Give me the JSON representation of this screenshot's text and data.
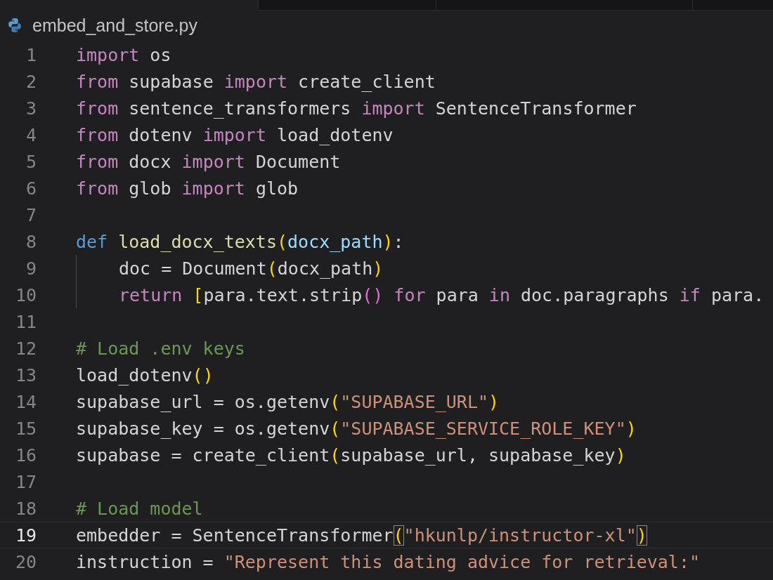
{
  "tab": {
    "title": "embed_and_store.py"
  },
  "lines": [
    {
      "number": "1",
      "current": false,
      "indent": false,
      "tokens": [
        {
          "kind": "keyword",
          "text": "import"
        },
        {
          "kind": "plain",
          "text": " os"
        }
      ]
    },
    {
      "number": "2",
      "current": false,
      "indent": false,
      "tokens": [
        {
          "kind": "keyword",
          "text": "from"
        },
        {
          "kind": "plain",
          "text": " supabase "
        },
        {
          "kind": "keyword",
          "text": "import"
        },
        {
          "kind": "plain",
          "text": " create_client"
        }
      ]
    },
    {
      "number": "3",
      "current": false,
      "indent": false,
      "tokens": [
        {
          "kind": "keyword",
          "text": "from"
        },
        {
          "kind": "plain",
          "text": " sentence_transformers "
        },
        {
          "kind": "keyword",
          "text": "import"
        },
        {
          "kind": "plain",
          "text": " SentenceTransformer"
        }
      ]
    },
    {
      "number": "4",
      "current": false,
      "indent": false,
      "tokens": [
        {
          "kind": "keyword",
          "text": "from"
        },
        {
          "kind": "plain",
          "text": " dotenv "
        },
        {
          "kind": "keyword",
          "text": "import"
        },
        {
          "kind": "plain",
          "text": " load_dotenv"
        }
      ]
    },
    {
      "number": "5",
      "current": false,
      "indent": false,
      "tokens": [
        {
          "kind": "keyword",
          "text": "from"
        },
        {
          "kind": "plain",
          "text": " docx "
        },
        {
          "kind": "keyword",
          "text": "import"
        },
        {
          "kind": "plain",
          "text": " Document"
        }
      ]
    },
    {
      "number": "6",
      "current": false,
      "indent": false,
      "tokens": [
        {
          "kind": "keyword",
          "text": "from"
        },
        {
          "kind": "plain",
          "text": " glob "
        },
        {
          "kind": "keyword",
          "text": "import"
        },
        {
          "kind": "plain",
          "text": " glob"
        }
      ]
    },
    {
      "number": "7",
      "current": false,
      "indent": false
    },
    {
      "number": "8",
      "current": false,
      "indent": false,
      "tokens": [
        {
          "kind": "storage",
          "text": "def"
        },
        {
          "kind": "func",
          "text": " load_docx_texts"
        },
        {
          "kind": "paren",
          "text": "("
        },
        {
          "kind": "param",
          "text": "docx_path"
        },
        {
          "kind": "paren",
          "text": ")"
        },
        {
          "kind": "plain",
          "text": ":"
        }
      ]
    },
    {
      "number": "9",
      "current": false,
      "indent": true,
      "tokens": [
        {
          "kind": "plain",
          "text": "doc = Document"
        },
        {
          "kind": "paren",
          "text": "("
        },
        {
          "kind": "plain",
          "text": "docx_path"
        },
        {
          "kind": "paren",
          "text": ")"
        }
      ]
    },
    {
      "number": "10",
      "current": false,
      "indent": true,
      "tokens": [
        {
          "kind": "keyword",
          "text": "return"
        },
        {
          "kind": "paren",
          "text": " ["
        },
        {
          "kind": "plain",
          "text": "para.text.strip"
        },
        {
          "kind": "bracket2",
          "text": "()"
        },
        {
          "kind": "keyword",
          "text": " for"
        },
        {
          "kind": "plain",
          "text": " para "
        },
        {
          "kind": "keyword",
          "text": "in"
        },
        {
          "kind": "plain",
          "text": " doc.paragraphs "
        },
        {
          "kind": "keyword",
          "text": "if"
        },
        {
          "kind": "plain",
          "text": " para."
        }
      ]
    },
    {
      "number": "11",
      "current": false,
      "indent": false
    },
    {
      "number": "12",
      "current": false,
      "indent": false,
      "tokens": [
        {
          "kind": "comment",
          "text": "# Load .env keys"
        }
      ]
    },
    {
      "number": "13",
      "current": false,
      "indent": false,
      "tokens": [
        {
          "kind": "plain",
          "text": "load_dotenv"
        },
        {
          "kind": "paren",
          "text": "()"
        }
      ]
    },
    {
      "number": "14",
      "current": false,
      "indent": false,
      "tokens": [
        {
          "kind": "plain",
          "text": "supabase_url = os.getenv"
        },
        {
          "kind": "paren",
          "text": "("
        },
        {
          "kind": "string",
          "text": "\"SUPABASE_URL\""
        },
        {
          "kind": "paren",
          "text": ")"
        }
      ]
    },
    {
      "number": "15",
      "current": false,
      "indent": false,
      "tokens": [
        {
          "kind": "plain",
          "text": "supabase_key = os.getenv"
        },
        {
          "kind": "paren",
          "text": "("
        },
        {
          "kind": "string",
          "text": "\"SUPABASE_SERVICE_ROLE_KEY\""
        },
        {
          "kind": "paren",
          "text": ")"
        }
      ]
    },
    {
      "number": "16",
      "current": false,
      "indent": false,
      "tokens": [
        {
          "kind": "plain",
          "text": "supabase = create_client"
        },
        {
          "kind": "paren",
          "text": "("
        },
        {
          "kind": "plain",
          "text": "supabase_url, supabase_key"
        },
        {
          "kind": "paren",
          "text": ")"
        }
      ]
    },
    {
      "number": "17",
      "current": false,
      "indent": false
    },
    {
      "number": "18",
      "current": false,
      "indent": false,
      "tokens": [
        {
          "kind": "comment",
          "text": "# Load model"
        }
      ]
    },
    {
      "number": "19",
      "current": true,
      "indent": false,
      "tokens": [
        {
          "kind": "plain",
          "text": "embedder = SentenceTransformer"
        },
        {
          "kind": "match",
          "text": "("
        },
        {
          "kind": "string",
          "text": "\"hkunlp/instructor-xl\""
        },
        {
          "kind": "match",
          "text": ")"
        }
      ]
    },
    {
      "number": "20",
      "current": false,
      "indent": false,
      "tokens": [
        {
          "kind": "plain",
          "text": "instruction = "
        },
        {
          "kind": "string",
          "text": "\"Represent this dating advice for retrieval:\""
        }
      ]
    }
  ]
}
